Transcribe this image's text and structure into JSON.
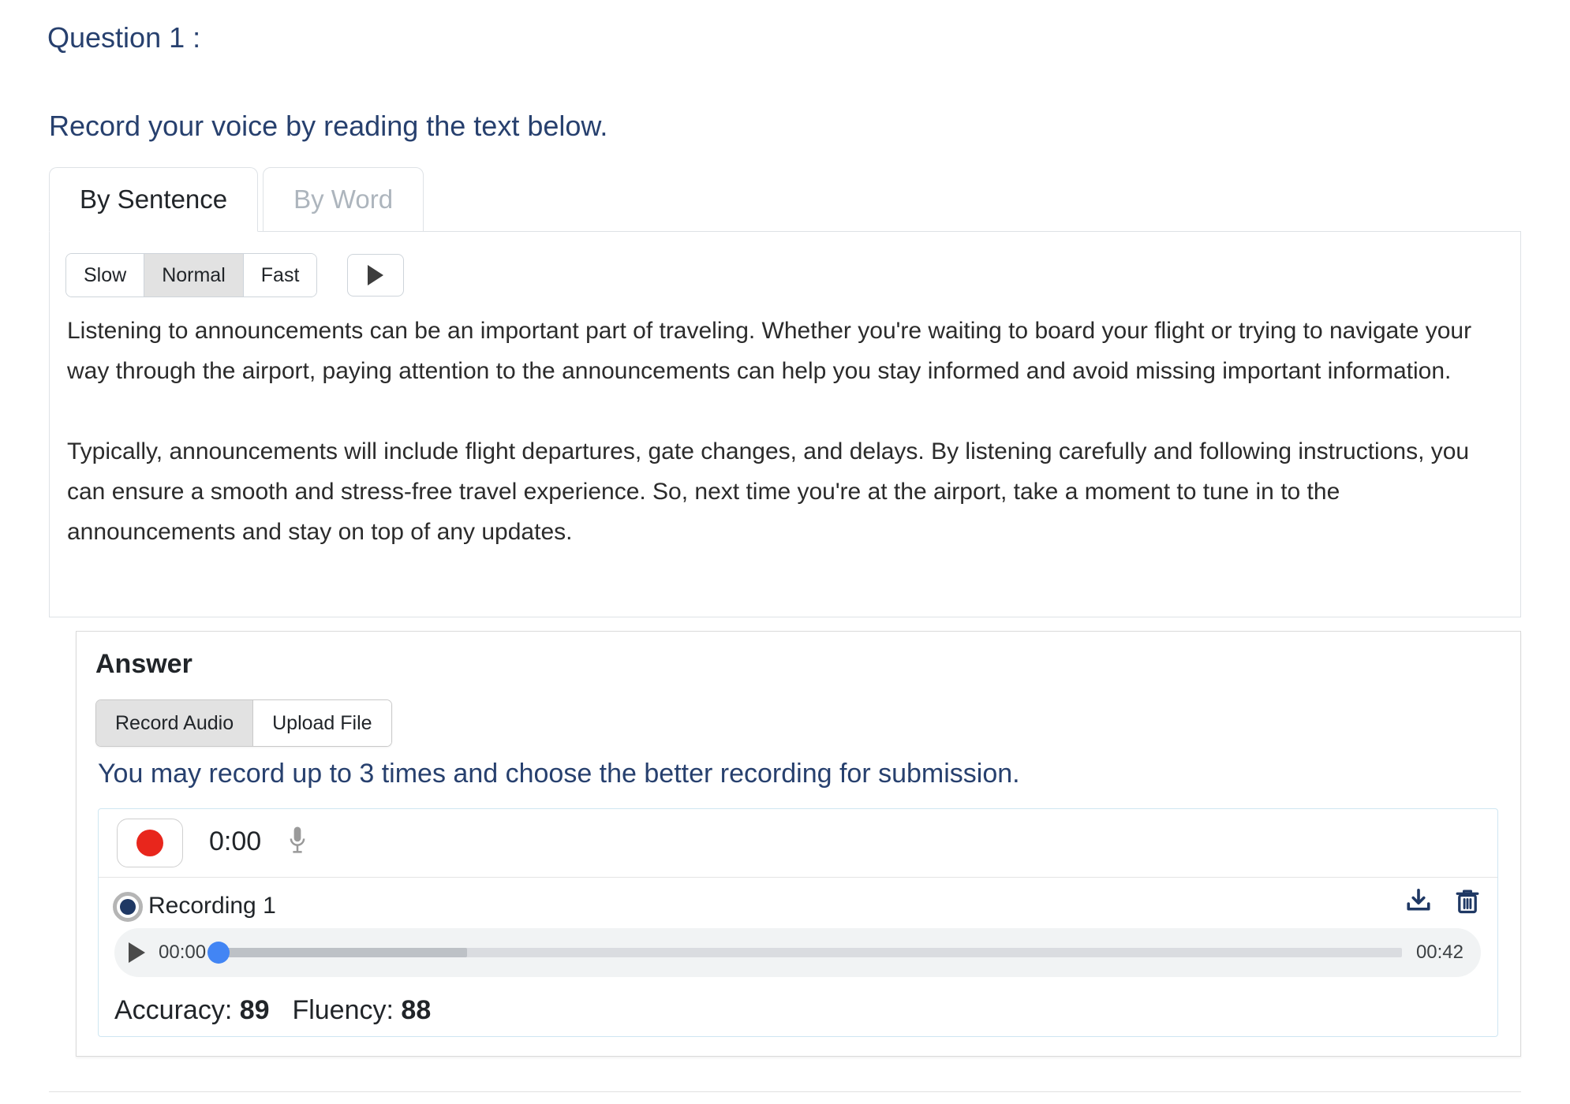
{
  "question": {
    "label": "Question 1 :",
    "prompt": "Record your voice by reading the text below."
  },
  "reading_tabs": [
    {
      "label": "By Sentence",
      "active": true
    },
    {
      "label": "By Word",
      "active": false
    }
  ],
  "speed_control": {
    "options": [
      "Slow",
      "Normal",
      "Fast"
    ],
    "slow_label": "Slow",
    "normal_label": "Normal",
    "fast_label": "Fast",
    "selected": "Normal",
    "play_icon": "play-icon"
  },
  "passage": {
    "paragraph_1": "Listening to announcements can be an important part of traveling. Whether you're waiting to board your flight or trying to navigate your way through the airport, paying attention to the announcements can help you stay informed and avoid missing important information.",
    "paragraph_2": "Typically, announcements will include flight departures, gate changes, and delays. By listening carefully and following instructions, you can ensure a smooth and stress-free travel experience. So, next time you're at the airport, take a moment to tune in to the announcements and stay on top of any updates."
  },
  "answer": {
    "title": "Answer",
    "modes": [
      {
        "label": "Record Audio",
        "selected": true
      },
      {
        "label": "Upload File",
        "selected": false
      }
    ],
    "record_audio_label": "Record Audio",
    "upload_file_label": "Upload File",
    "limit_note": "You may record up to 3 times and choose the better recording for submission.",
    "recorder": {
      "record_button_icon": "record-dot-icon",
      "timer": "0:00",
      "mic_icon": "microphone-icon"
    },
    "recordings": [
      {
        "name": "Recording 1",
        "selected": true,
        "current_time": "00:00",
        "duration": "00:42",
        "progress_percent": 0,
        "buffered_percent": 21,
        "accuracy_label": "Accuracy:",
        "accuracy_value": "89",
        "fluency_label": "Fluency:",
        "fluency_value": "88",
        "download_icon": "download-icon",
        "delete_icon": "trash-icon"
      }
    ]
  },
  "colors": {
    "heading_blue": "#27406e",
    "record_red": "#e8261c",
    "thumb_blue": "#4285f4",
    "radio_navy": "#1f3864",
    "icon_navy": "#1f3864"
  }
}
